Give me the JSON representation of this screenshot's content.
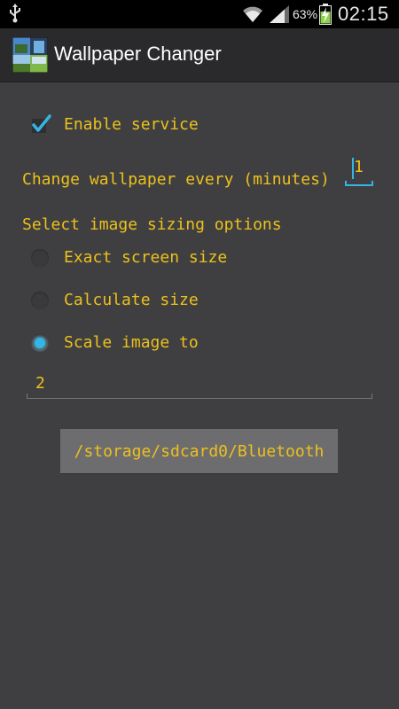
{
  "status_bar": {
    "battery_percent": "63%",
    "time": "02:15",
    "icons": [
      "usb-icon",
      "wifi-icon",
      "signal-icon",
      "battery-charging-icon"
    ]
  },
  "action_bar": {
    "title": "Wallpaper Changer",
    "icon": "app-icon"
  },
  "settings": {
    "enable_service": {
      "label": "Enable service",
      "checked": true
    },
    "interval": {
      "label": "Change wallpaper every (minutes)",
      "value": "1"
    },
    "sizing_header": "Select image sizing options",
    "sizing_options": [
      {
        "label": "Exact screen size",
        "selected": false
      },
      {
        "label": "Calculate size",
        "selected": false
      },
      {
        "label": "Scale image to",
        "selected": true
      }
    ],
    "scale_value": "2",
    "folder_button": "/storage/sdcard0/Bluetooth"
  },
  "colors": {
    "background": "#3f3f41",
    "accent_text": "#ecc11c",
    "holo_blue": "#33b5e5",
    "action_bar": "#2a2a2c"
  }
}
